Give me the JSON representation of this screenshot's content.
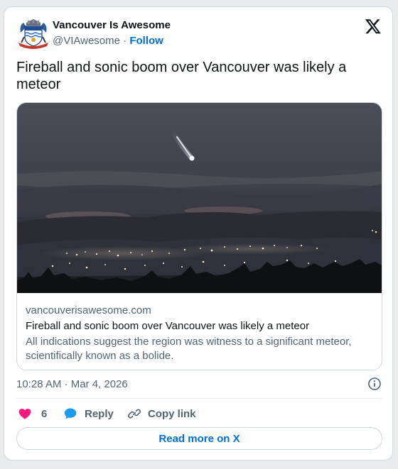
{
  "author": {
    "name": "Vancouver Is Awesome",
    "handle": "@VIAwesome",
    "separator": "·",
    "follow_label": "Follow"
  },
  "tweet": {
    "text": "Fireball and sonic boom over Vancouver was likely a meteor"
  },
  "link_card": {
    "domain": "vancouverisawesome.com",
    "title": "Fireball and sonic boom over Vancouver was likely a meteor",
    "description": "All indications suggest the region was witness to a significant meteor, scientifically known as a bolide."
  },
  "meta": {
    "timestamp": "10:28 AM · Mar 4, 2026"
  },
  "actions": {
    "like_count": "6",
    "reply_label": "Reply",
    "copy_label": "Copy link",
    "read_more_label": "Read more on X"
  },
  "icons": {
    "logo": "x-logo-icon",
    "info": "info-icon",
    "like": "heart-icon",
    "reply": "speech-bubble-icon",
    "copy": "link-icon"
  },
  "colors": {
    "text": "#0f1419",
    "secondary": "#536471",
    "link": "#006fd6",
    "like": "#f91880",
    "reply": "#1d9bf0",
    "border": "#cfd9de"
  }
}
